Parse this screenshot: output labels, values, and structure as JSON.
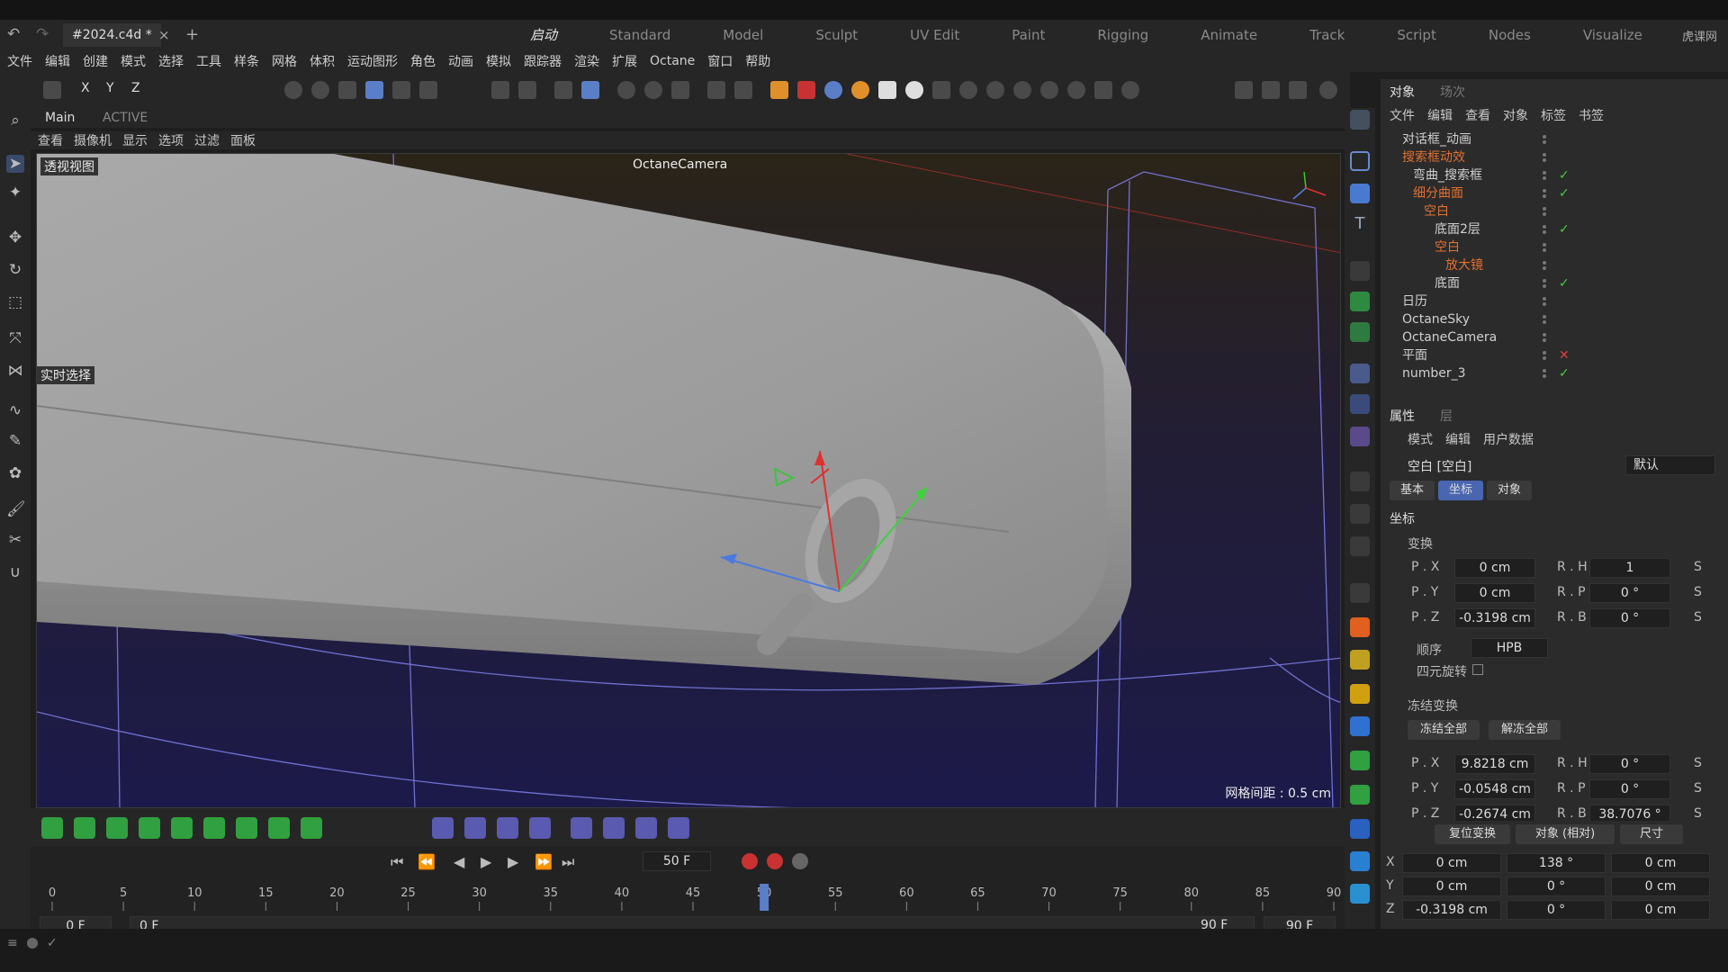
{
  "window": {
    "doc_tab": "#2024.c4d *",
    "close": "×",
    "plus": "+"
  },
  "layouts": [
    "启动",
    "Standard",
    "Model",
    "Sculpt",
    "UV Edit",
    "Paint",
    "Rigging",
    "Animate",
    "Track",
    "Script",
    "Nodes",
    "Visualize"
  ],
  "watermark": "虎课网",
  "menubar": [
    "文件",
    "编辑",
    "创建",
    "模式",
    "选择",
    "工具",
    "样条",
    "网格",
    "体积",
    "运动图形",
    "角色",
    "动画",
    "模拟",
    "跟踪器",
    "渲染",
    "扩展",
    "Octane",
    "窗口",
    "帮助"
  ],
  "axes_toolbar": [
    "X",
    "Y",
    "Z"
  ],
  "viewport": {
    "tabs": [
      "Main",
      "ACTIVE"
    ],
    "menu": [
      "查看",
      "摄像机",
      "显示",
      "选项",
      "过滤",
      "面板"
    ],
    "view_name": "透视视图",
    "camera_label": "OctaneCamera",
    "live_select": "实时选择",
    "grid_spacing": "网格间距 : 0.5 cm"
  },
  "object_panel": {
    "tabs": [
      "对象",
      "场次"
    ],
    "menu": [
      "文件",
      "编辑",
      "查看",
      "对象",
      "标签",
      "书签"
    ],
    "items": [
      {
        "name": "对话框_动画",
        "color": "#d0d0d0",
        "flag": ""
      },
      {
        "name": "搜索框动效",
        "color": "#e07030",
        "flag": ""
      },
      {
        "name": "弯曲_搜索框",
        "color": "#d0d0d0",
        "flag": "✓"
      },
      {
        "name": "细分曲面",
        "color": "#e07030",
        "flag": "✓"
      },
      {
        "name": "空白",
        "color": "#e07030",
        "flag": ""
      },
      {
        "name": "底面2层",
        "color": "#d0d0d0",
        "flag": "✓"
      },
      {
        "name": "空白",
        "color": "#e07030",
        "flag": ""
      },
      {
        "name": "放大镜",
        "color": "#e07030",
        "flag": ""
      },
      {
        "name": "底面",
        "color": "#d0d0d0",
        "flag": "✓"
      },
      {
        "name": "日历",
        "color": "#d0d0d0",
        "flag": ""
      },
      {
        "name": "OctaneSky",
        "color": "#d0d0d0",
        "flag": ""
      },
      {
        "name": "OctaneCamera",
        "color": "#d0d0d0",
        "flag": ""
      },
      {
        "name": "平面",
        "color": "#d0d0d0",
        "flag": "✕"
      },
      {
        "name": "number_3",
        "color": "#d0d0d0",
        "flag": "✓"
      }
    ]
  },
  "attributes": {
    "tabs": [
      "属性",
      "层"
    ],
    "menu": [
      "模式",
      "编辑",
      "用户数据"
    ],
    "object_title": "空白 [空白]",
    "preset": "默认",
    "subtabs": [
      "基本",
      "坐标",
      "对象"
    ],
    "section": "坐标",
    "transform_group": "变换",
    "rows": [
      {
        "label": "P . X",
        "value": "0 cm",
        "rlabel": "R . H",
        "rvalue": "1",
        "s": "S"
      },
      {
        "label": "P . Y",
        "value": "0 cm",
        "rlabel": "R . P",
        "rvalue": "0 °",
        "s": "S"
      },
      {
        "label": "P . Z",
        "value": "-0.3198 cm",
        "rlabel": "R . B",
        "rvalue": "0 °",
        "s": "S"
      }
    ],
    "order_label": "顺序",
    "order_value": "HPB",
    "quat_label": "四元旋转",
    "freeze_group": "冻结变换",
    "freeze_all": "冻结全部",
    "unfreeze_all": "解冻全部",
    "frozen_rows": [
      {
        "label": "P . X",
        "value": "9.8218 cm",
        "rlabel": "R . H",
        "rvalue": "0 °",
        "s": "S"
      },
      {
        "label": "P . Y",
        "value": "-0.0548 cm",
        "rlabel": "R . P",
        "rvalue": "0 °",
        "s": "S"
      },
      {
        "label": "P . Z",
        "value": "-0.2674 cm",
        "rlabel": "R . B",
        "rvalue": "38.7076 °",
        "s": "S"
      }
    ]
  },
  "coord_manager": {
    "buttons": [
      "复位变换",
      "对象 (相对)",
      "尺寸"
    ],
    "rows": [
      {
        "axis": "X",
        "pos": "0 cm",
        "rot": "138 °",
        "size": "0 cm"
      },
      {
        "axis": "Y",
        "pos": "0 cm",
        "rot": "0 °",
        "size": "0 cm"
      },
      {
        "axis": "Z",
        "pos": "-0.3198 cm",
        "rot": "0 °",
        "size": "0 cm"
      }
    ]
  },
  "timeline": {
    "current_frame": "50 F",
    "start": "0 F",
    "start2": "0 F",
    "end": "90 F",
    "end2": "90 F",
    "ticks": [
      "0",
      "5",
      "10",
      "15",
      "20",
      "25",
      "30",
      "35",
      "40",
      "45",
      "50",
      "55",
      "60",
      "65",
      "70",
      "75",
      "80",
      "85",
      "90"
    ],
    "playhead_frame": 50
  }
}
